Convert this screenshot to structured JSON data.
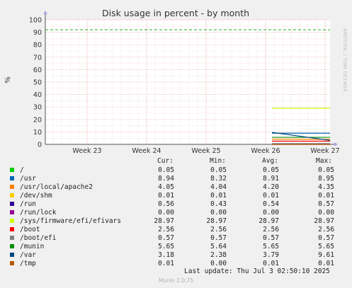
{
  "chart_data": {
    "type": "line",
    "title": "Disk usage in percent - by month",
    "ylabel": "%",
    "xlabel": "",
    "ylim": [
      0,
      100
    ],
    "y_ticks": [
      "0",
      "10",
      "20",
      "30",
      "40",
      "50",
      "60",
      "70",
      "80",
      "90",
      "100"
    ],
    "x_ticks": [
      "Week 23",
      "Week 24",
      "Week 25",
      "Week 26",
      "Week 27"
    ],
    "grid": true,
    "warning_line": 92,
    "series": [
      {
        "name": "/",
        "color": "#00cc00",
        "values": [
          0.05,
          0.05
        ]
      },
      {
        "name": "/usr",
        "color": "#0066b3",
        "values": [
          8.95,
          8.94
        ]
      },
      {
        "name": "/usr/local/apache2",
        "color": "#ff8000",
        "values": [
          4.04,
          4.05
        ]
      },
      {
        "name": "/dev/shm",
        "color": "#ffcc00",
        "values": [
          0.01,
          0.01
        ]
      },
      {
        "name": "/run",
        "color": "#330099",
        "values": [
          0.57,
          0.56
        ]
      },
      {
        "name": "/run/lock",
        "color": "#990099",
        "values": [
          0.0,
          0.0
        ]
      },
      {
        "name": "/sys/firmware/efi/efivars",
        "color": "#ccff00",
        "values": [
          28.97,
          28.97
        ]
      },
      {
        "name": "/boot",
        "color": "#ff0000",
        "values": [
          2.56,
          2.56
        ]
      },
      {
        "name": "/boot/efi",
        "color": "#808080",
        "values": [
          0.57,
          0.57
        ]
      },
      {
        "name": "/munin",
        "color": "#008f00",
        "values": [
          5.65,
          5.65
        ]
      },
      {
        "name": "/var",
        "color": "#00487d",
        "values": [
          9.61,
          3.18
        ]
      },
      {
        "name": "/tmp",
        "color": "#b35a00",
        "values": [
          0.01,
          0.01
        ]
      }
    ]
  },
  "side_label": "RRDTOOL / TOBI OETIKER",
  "legend": {
    "headers": {
      "cur": "Cur:",
      "min": "Min:",
      "avg": "Avg:",
      "max": "Max:"
    },
    "rows": [
      {
        "name": "/",
        "color": "#00cc00",
        "cur": "0.05",
        "min": "0.05",
        "avg": "0.05",
        "max": "0.05"
      },
      {
        "name": "/usr",
        "color": "#0066b3",
        "cur": "8.94",
        "min": "8.32",
        "avg": "8.91",
        "max": "8.95"
      },
      {
        "name": "/usr/local/apache2",
        "color": "#ff8000",
        "cur": "4.05",
        "min": "4.04",
        "avg": "4.20",
        "max": "4.35"
      },
      {
        "name": "/dev/shm",
        "color": "#ffcc00",
        "cur": "0.01",
        "min": "0.01",
        "avg": "0.01",
        "max": "0.01"
      },
      {
        "name": "/run",
        "color": "#330099",
        "cur": "0.56",
        "min": "0.43",
        "avg": "0.54",
        "max": "0.57"
      },
      {
        "name": "/run/lock",
        "color": "#990099",
        "cur": "0.00",
        "min": "0.00",
        "avg": "0.00",
        "max": "0.00"
      },
      {
        "name": "/sys/firmware/efi/efivars",
        "color": "#ccff00",
        "cur": "28.97",
        "min": "28.97",
        "avg": "28.97",
        "max": "28.97"
      },
      {
        "name": "/boot",
        "color": "#ff0000",
        "cur": "2.56",
        "min": "2.56",
        "avg": "2.56",
        "max": "2.56"
      },
      {
        "name": "/boot/efi",
        "color": "#808080",
        "cur": "0.57",
        "min": "0.57",
        "avg": "0.57",
        "max": "0.57"
      },
      {
        "name": "/munin",
        "color": "#008f00",
        "cur": "5.65",
        "min": "5.64",
        "avg": "5.65",
        "max": "5.65"
      },
      {
        "name": "/var",
        "color": "#00487d",
        "cur": "3.18",
        "min": "2.38",
        "avg": "3.79",
        "max": "9.61"
      },
      {
        "name": "/tmp",
        "color": "#b35a00",
        "cur": "0.01",
        "min": "0.00",
        "avg": "0.01",
        "max": "0.01"
      }
    ]
  },
  "last_update": "Last update: Thu Jul  3 02:50:10 2025",
  "version": "Munin 2.0.75"
}
